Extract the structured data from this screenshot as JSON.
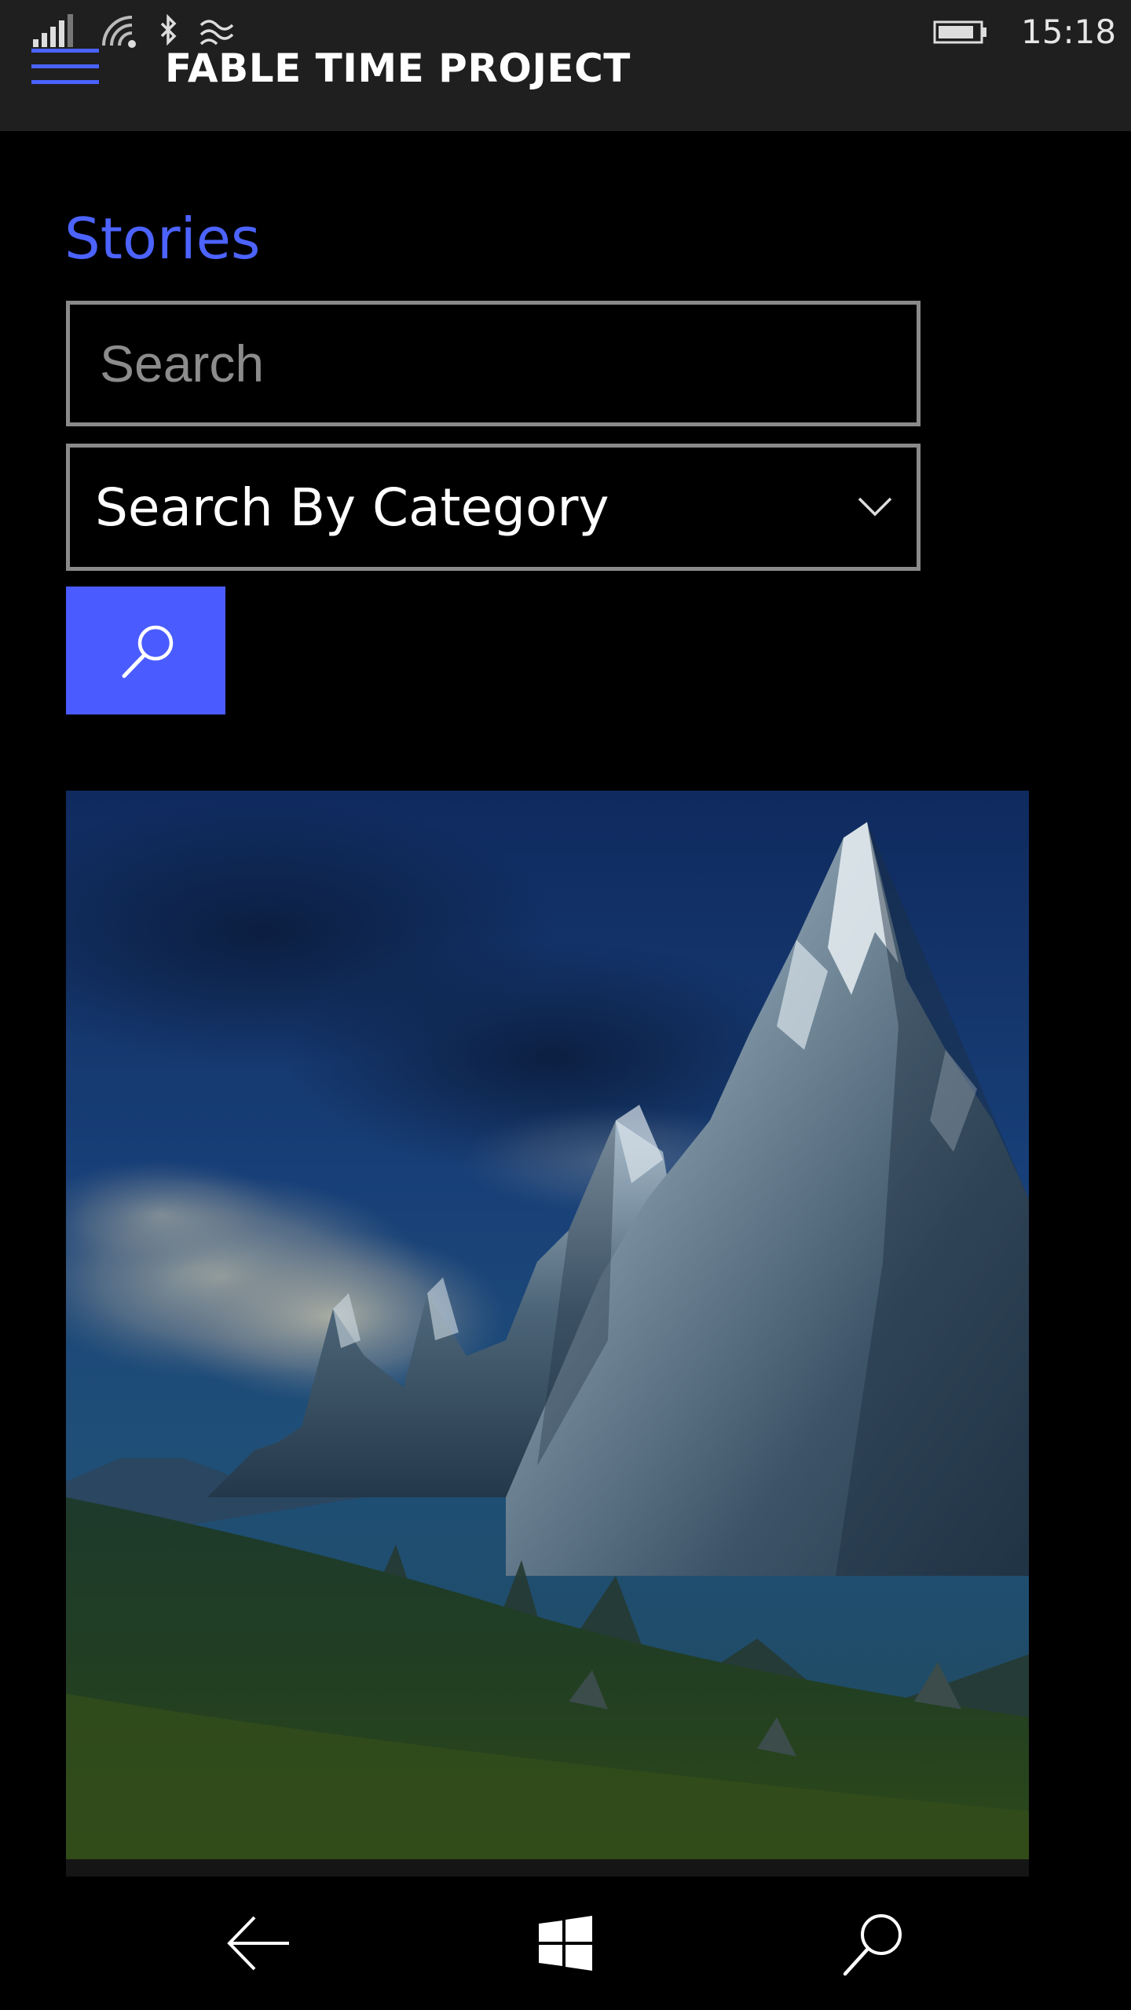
{
  "status_bar": {
    "time": "15:18"
  },
  "app": {
    "title": "FABLE TIME PROJECT"
  },
  "main": {
    "section_title": "Stories",
    "search": {
      "placeholder": "Search",
      "value": ""
    },
    "category": {
      "selected": "Search By Category"
    }
  },
  "icons": {
    "menu": "hamburger-icon",
    "search": "search-icon",
    "dropdown": "chevron-down-icon",
    "back": "back-arrow-icon",
    "start": "windows-logo-icon",
    "nav_search": "search-icon"
  },
  "colors": {
    "accent": "#4a5cff",
    "title_bar": "#1f1f1f",
    "background": "#000000",
    "border": "#8a8a8a"
  }
}
